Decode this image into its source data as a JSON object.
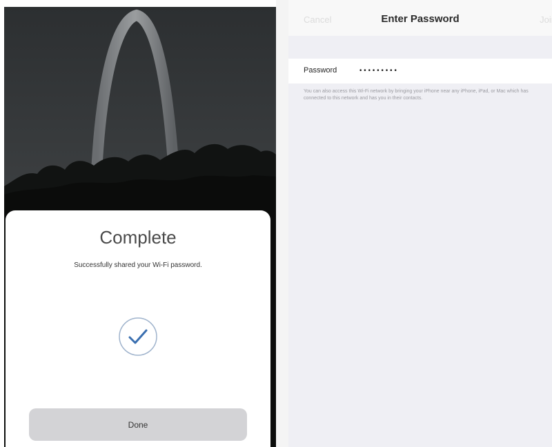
{
  "left_screen": {
    "sheet": {
      "title": "Complete",
      "subtitle": "Successfully shared your Wi-Fi password.",
      "status_icon": "checkmark-circle-icon",
      "done_label": "Done"
    }
  },
  "right_screen": {
    "nav": {
      "cancel_label": "Cancel",
      "title": "Enter Password",
      "join_label": "Join"
    },
    "password": {
      "label": "Password",
      "value": "•••••••••"
    },
    "help_text": "You can also access this Wi-Fi network by bringing your iPhone near any iPhone, iPad, or Mac which has connected to this network and has you in their contacts."
  },
  "colors": {
    "accent": "#3a6fb0",
    "sheet_background": "#ffffff",
    "settings_background": "#efeff4",
    "done_button": "#d3d3d6"
  }
}
